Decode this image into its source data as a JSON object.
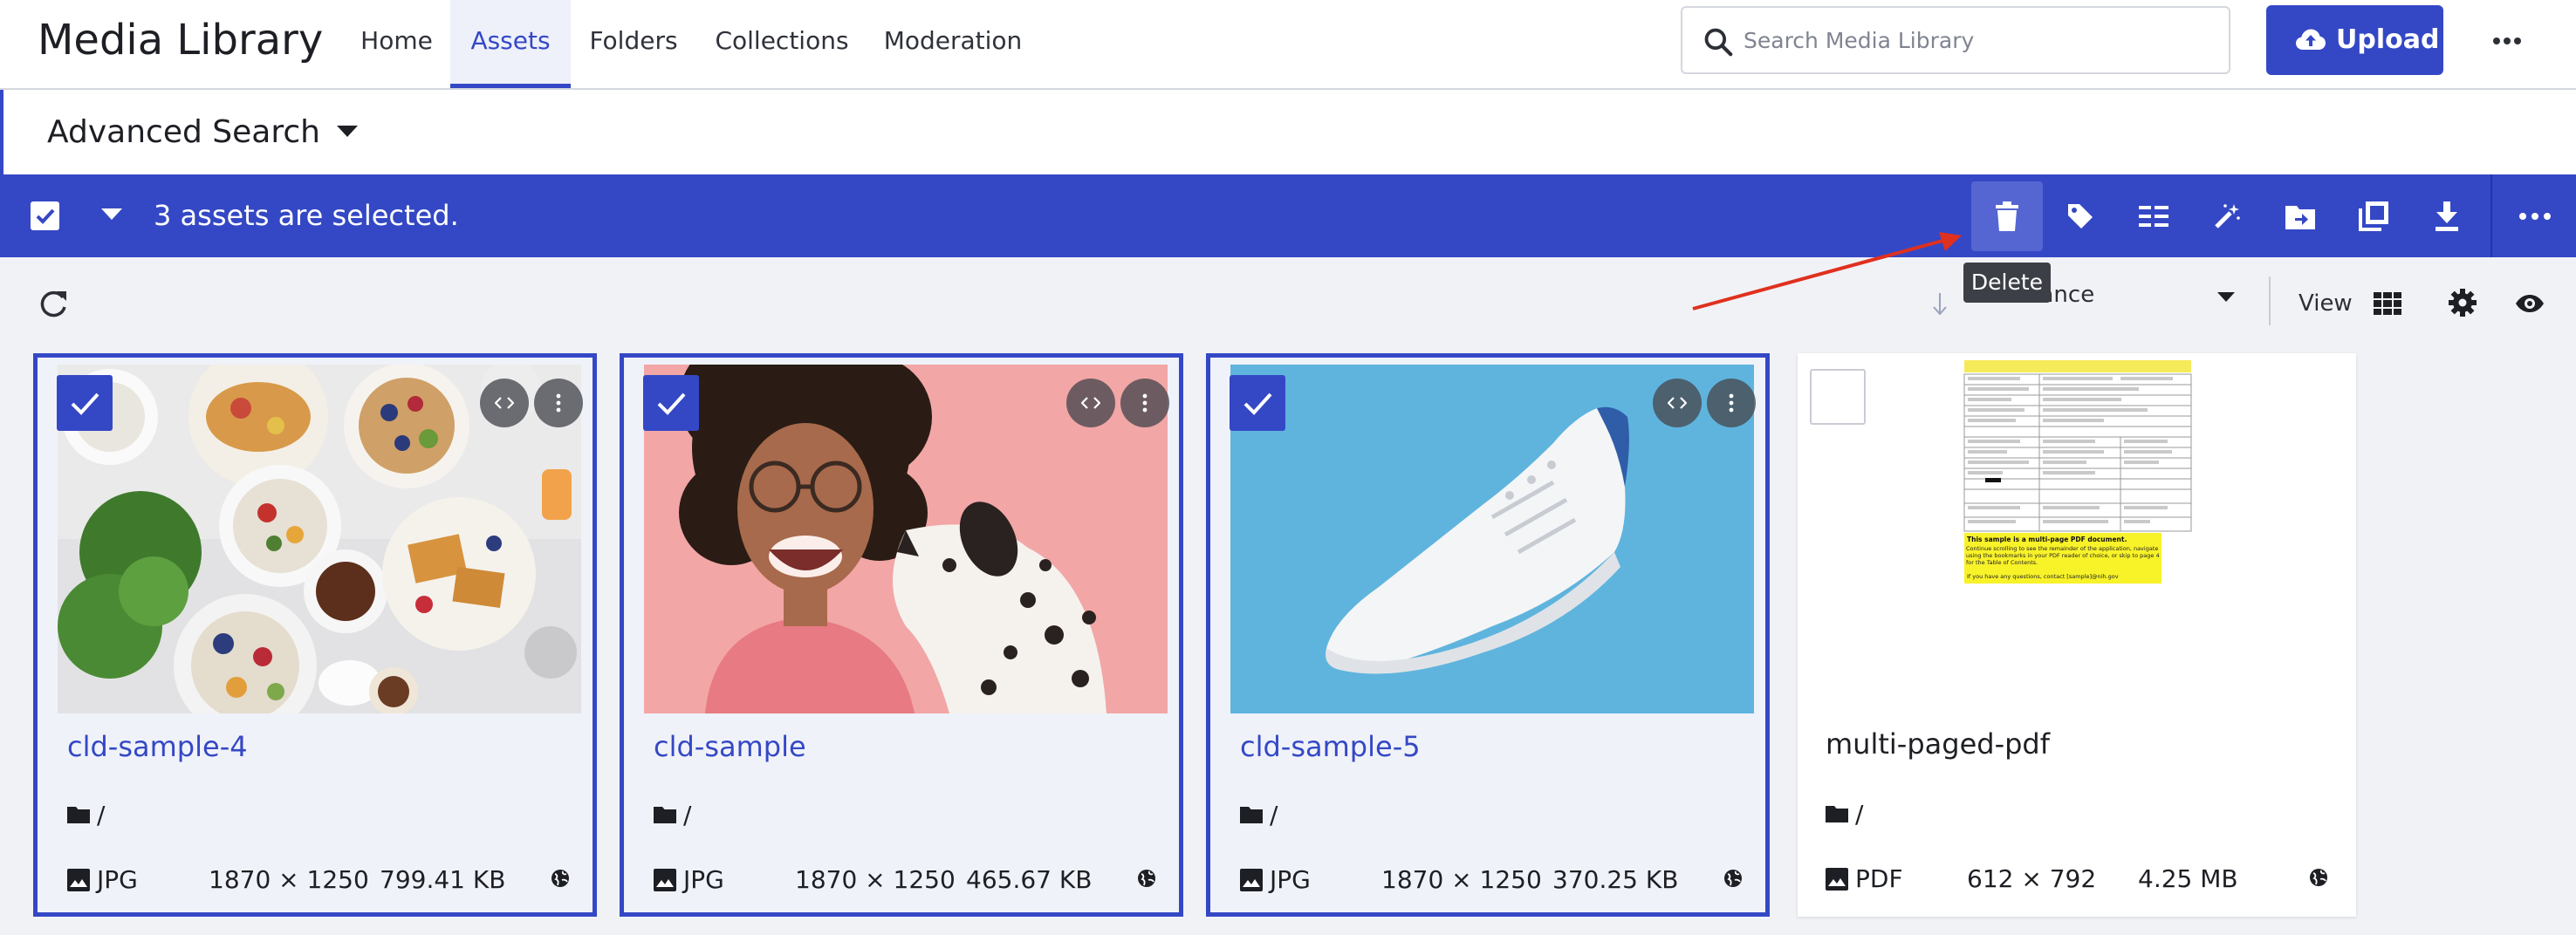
{
  "header": {
    "title": "Media Library",
    "nav": [
      {
        "label": "Home",
        "active": false
      },
      {
        "label": "Assets",
        "active": true
      },
      {
        "label": "Folders",
        "active": false
      },
      {
        "label": "Collections",
        "active": false
      },
      {
        "label": "Moderation",
        "active": false
      }
    ],
    "search_placeholder": "Search Media Library",
    "upload_label": "Upload"
  },
  "advanced_search": {
    "label": "Advanced Search"
  },
  "selection": {
    "text": "3 assets are selected.",
    "actions": [
      "trash-icon",
      "tag-icon",
      "metadata-icon",
      "magic-wand-icon",
      "move-to-folder-icon",
      "copy-icon",
      "download-icon"
    ],
    "tooltip": "Delete"
  },
  "toolbar": {
    "sort_value": "Relevance",
    "view_label": "View"
  },
  "assets": [
    {
      "name": "cld-sample-4",
      "folder": "/",
      "format": "JPG",
      "dimensions": "1870 × 1250",
      "size": "799.41 KB",
      "selected": true
    },
    {
      "name": "cld-sample",
      "folder": "/",
      "format": "JPG",
      "dimensions": "1870 × 1250",
      "size": "465.67 KB",
      "selected": true
    },
    {
      "name": "cld-sample-5",
      "folder": "/",
      "format": "JPG",
      "dimensions": "1870 × 1250",
      "size": "370.25 KB",
      "selected": true
    },
    {
      "name": "multi-paged-pdf",
      "folder": "/",
      "format": "PDF",
      "dimensions": "612 × 792",
      "size": "4.25 MB",
      "selected": false
    }
  ],
  "pdf_preview": {
    "highlight_title": "This sample is a multi-page PDF document.",
    "highlight_body": "Continue scrolling to see the remainder of the application, navigate using the bookmarks in your PDF reader of choice, or skip to page 4 for the Table of Contents.",
    "highlight_contact": "If you have any questions, contact [sample]@nih.gov"
  },
  "colors": {
    "accent": "#3448c5",
    "selection_bar": "#3448c5",
    "arrow": "#e0301e"
  }
}
